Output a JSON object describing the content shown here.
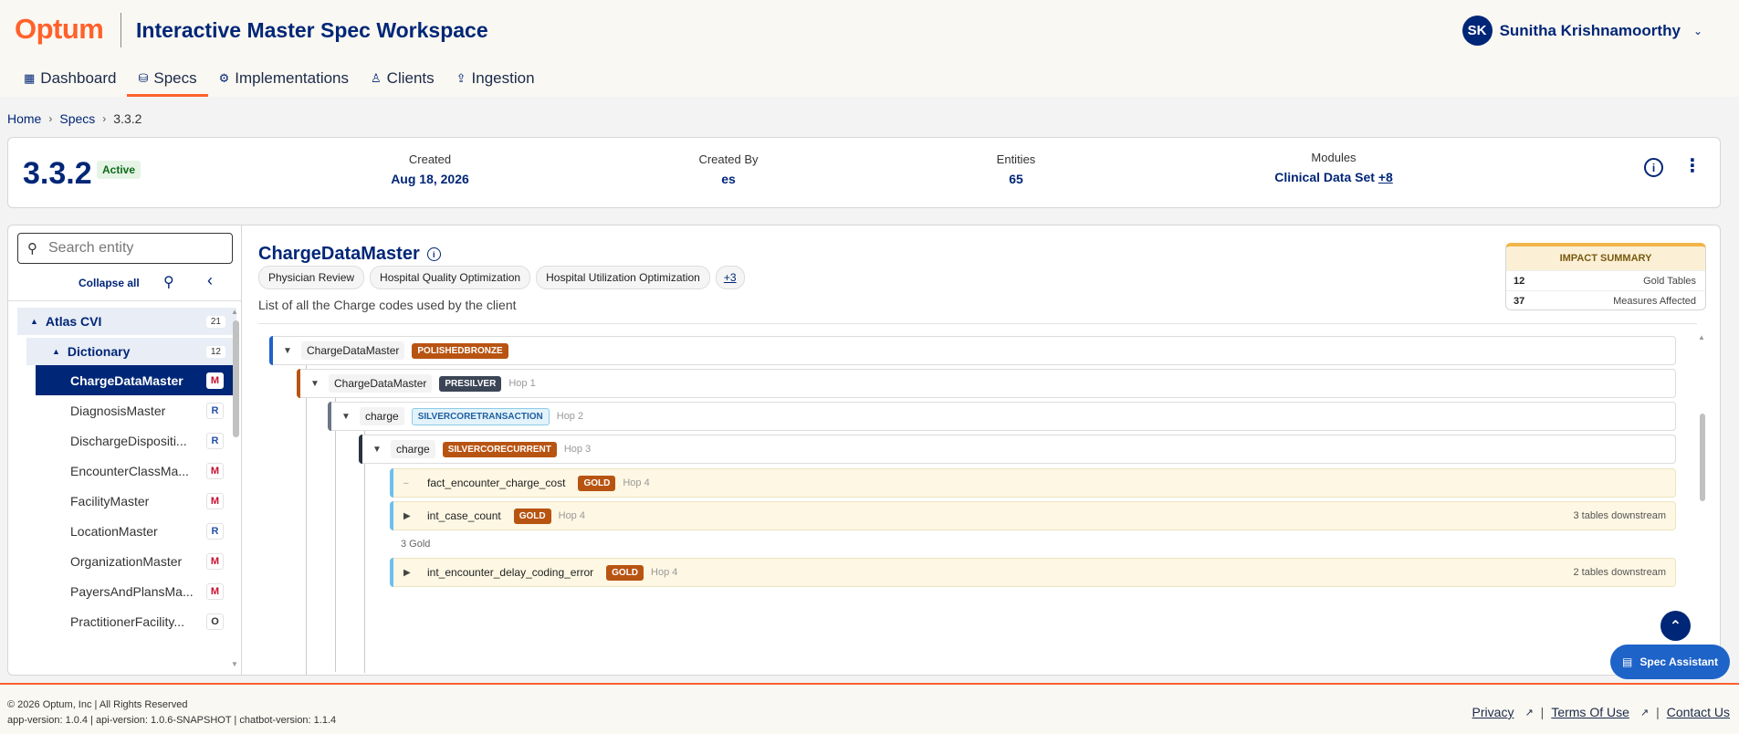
{
  "header": {
    "logo": "Optum",
    "app_title": "Interactive Master Spec Workspace",
    "user_initials": "SK",
    "user_name": "Sunitha Krishnamoorthy",
    "icons": {
      "user_menu": "chevron-down-icon"
    }
  },
  "nav": {
    "items": [
      {
        "label": "Dashboard",
        "icon": "grid-icon"
      },
      {
        "label": "Specs",
        "icon": "database-icon",
        "active": true
      },
      {
        "label": "Implementations",
        "icon": "gear-icon"
      },
      {
        "label": "Clients",
        "icon": "person-icon"
      },
      {
        "label": "Ingestion",
        "icon": "upload-icon"
      }
    ]
  },
  "breadcrumb": {
    "home": "Home",
    "specs": "Specs",
    "current": "3.3.2"
  },
  "spec": {
    "version": "3.3.2",
    "status": "Active",
    "created_label": "Created",
    "created_value": "Aug 18, 2026",
    "created_by_label": "Created By",
    "created_by_value": "es",
    "entities_label": "Entities",
    "entities_value": "65",
    "modules_label": "Modules",
    "modules_value": "Clinical Data Set",
    "modules_more": "+8"
  },
  "sidebar": {
    "search_placeholder": "Search entity",
    "collapse_all": "Collapse all",
    "groups": [
      {
        "label": "Atlas CVI",
        "count": "21"
      },
      {
        "label": "Dictionary",
        "count": "12"
      }
    ],
    "items": [
      {
        "label": "ChargeDataMaster",
        "tag": "M",
        "selected": true
      },
      {
        "label": "DiagnosisMaster",
        "tag": "R"
      },
      {
        "label": "DischargeDispositi...",
        "tag": "R"
      },
      {
        "label": "EncounterClassMa...",
        "tag": "M"
      },
      {
        "label": "FacilityMaster",
        "tag": "M"
      },
      {
        "label": "LocationMaster",
        "tag": "R"
      },
      {
        "label": "OrganizationMaster",
        "tag": "M"
      },
      {
        "label": "PayersAndPlansMa...",
        "tag": "M"
      },
      {
        "label": "PractitionerFacility...",
        "tag": "O"
      }
    ]
  },
  "entity": {
    "title": "ChargeDataMaster",
    "chips": [
      "Physician Review",
      "Hospital Quality Optimization",
      "Hospital Utilization Optimization"
    ],
    "chips_more": "+3",
    "description": "List of all the Charge codes used by the client"
  },
  "impact": {
    "title": "IMPACT SUMMARY",
    "rows": [
      {
        "n": "12",
        "label": "Gold Tables"
      },
      {
        "n": "37",
        "label": "Measures Affected"
      }
    ]
  },
  "lineage": {
    "rows": [
      {
        "name": "ChargeDataMaster",
        "badge": "POLISHEDBRONZE",
        "hop": "",
        "down": ""
      },
      {
        "name": "ChargeDataMaster",
        "badge": "PRESILVER",
        "hop": "Hop 1",
        "down": ""
      },
      {
        "name": "charge",
        "badge": "SILVERCORETRANSACTION",
        "hop": "Hop 2",
        "down": ""
      },
      {
        "name": "charge",
        "badge": "SILVERCORECURRENT",
        "hop": "Hop 3",
        "down": ""
      },
      {
        "name": "fact_encounter_charge_cost",
        "badge": "GOLD",
        "hop": "Hop 4",
        "down": ""
      },
      {
        "name": "int_case_count",
        "badge": "GOLD",
        "hop": "Hop 4",
        "down": "3 tables downstream"
      },
      {
        "name": "int_encounter_delay_coding_error",
        "badge": "GOLD",
        "hop": "Hop 4",
        "down": "2 tables downstream"
      }
    ],
    "sub_gold": "3 Gold"
  },
  "assistant_label": "Spec Assistant",
  "footer": {
    "copyright": "© 2026 Optum, Inc | All Rights Reserved",
    "versions": "app-version: 1.0.4 | api-version: 1.0.6-SNAPSHOT | chatbot-version: 1.1.4",
    "privacy": "Privacy",
    "terms": "Terms Of Use",
    "contact": "Contact Us"
  }
}
